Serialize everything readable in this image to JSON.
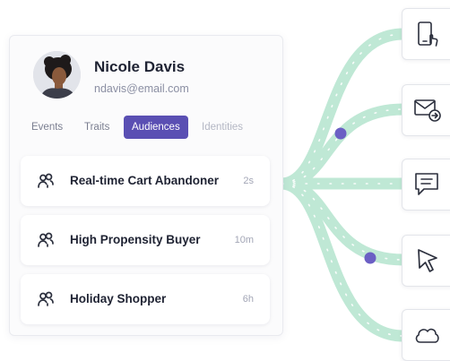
{
  "profile": {
    "name": "Nicole Davis",
    "email": "ndavis@email.com",
    "avatar_icon": "person-avatar"
  },
  "tabs": [
    {
      "label": "Events",
      "active": false
    },
    {
      "label": "Traits",
      "active": false
    },
    {
      "label": "Audiences",
      "active": true
    },
    {
      "label": "Identities",
      "active": false
    }
  ],
  "audiences": [
    {
      "title": "Real-time Cart Abandoner",
      "time": "2s",
      "icon": "people-icon"
    },
    {
      "title": "High Propensity Buyer",
      "time": "10m",
      "icon": "people-icon"
    },
    {
      "title": "Holiday Shopper",
      "time": "6h",
      "icon": "people-icon"
    }
  ],
  "destinations": [
    {
      "icon": "mobile-tap-icon"
    },
    {
      "icon": "email-forward-icon"
    },
    {
      "icon": "chat-message-icon"
    },
    {
      "icon": "cursor-icon"
    },
    {
      "icon": "cloud-icon"
    }
  ],
  "colors": {
    "accent": "#5a4fb3",
    "flow": "#b9e6d2",
    "dot": "#6b5fc4"
  }
}
